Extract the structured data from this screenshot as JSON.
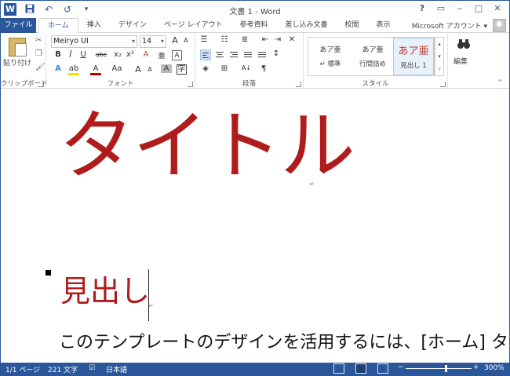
{
  "titlebar": {
    "title": "文書 1 - Word",
    "help": "?",
    "restore": "▭",
    "minimize": "‒",
    "maximize": "□",
    "close": "✕",
    "qat_save": "💾",
    "qat_undo": "↶",
    "qat_redo": "↺",
    "qat_more": "▾"
  },
  "tabs": {
    "file": "ファイル",
    "items": [
      "ホーム",
      "挿入",
      "デザイン",
      "ページ レイアウト",
      "参考資料",
      "差し込み文書",
      "校閲",
      "表示"
    ],
    "account": "Microsoft アカウント ▾"
  },
  "ribbon": {
    "clipboard": {
      "paste": "貼り付け",
      "label": "クリップボード"
    },
    "font": {
      "name": "Meiryo UI",
      "size": "14",
      "label": "フォント",
      "bold": "B",
      "italic": "I",
      "underline": "U",
      "strike": "abc",
      "sub": "x₂",
      "sup": "x²",
      "grow": "A",
      "shrink": "A",
      "case": "Aa",
      "clear": "A"
    },
    "paragraph": {
      "label": "段落"
    },
    "styles": {
      "label": "スタイル",
      "items": [
        {
          "sample": "あア亜",
          "name": "↵ 標準"
        },
        {
          "sample": "あア亜",
          "name": "行間詰め"
        },
        {
          "sample": "あア亜",
          "name": "見出し 1"
        }
      ]
    },
    "editing": {
      "label": "編集"
    }
  },
  "document": {
    "title": "タイトル",
    "heading": "見出し",
    "body": "このテンプレートのデザインを活用するには、[ホーム] タブの",
    "para_mark": "↵"
  },
  "status": {
    "page": "1/1 ページ",
    "words": "221 文字",
    "language": "日本語",
    "zoom": "300%",
    "zoom_minus": "−",
    "zoom_plus": "+"
  }
}
